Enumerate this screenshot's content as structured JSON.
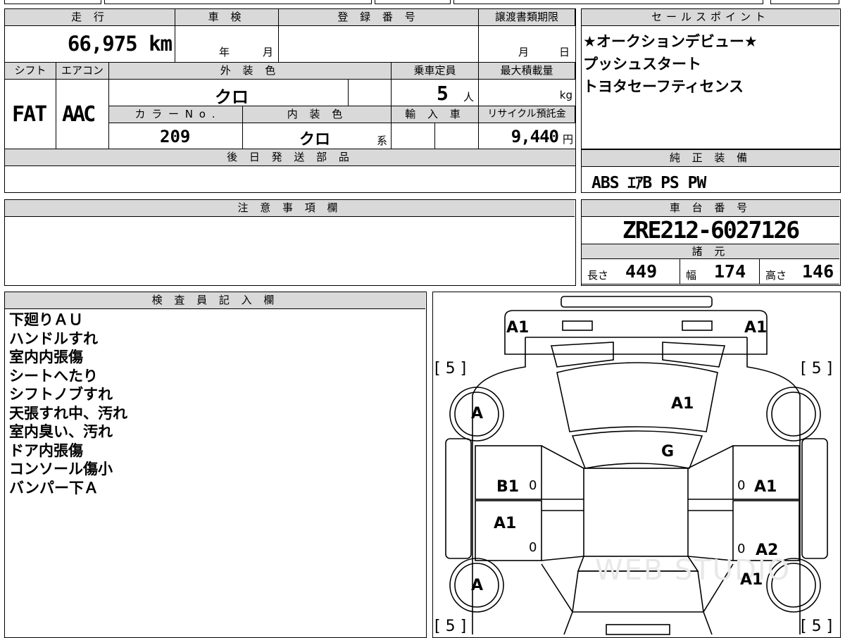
{
  "summary": {
    "mileage_label": "走 行",
    "mileage_value": "66,975 km",
    "shaken_label": "車 検",
    "shaken_year": "年",
    "shaken_month": "月",
    "registration_label": "登 録 番 号",
    "transfer_label": "譲渡書類期限",
    "transfer_month": "月",
    "transfer_day": "日",
    "shift_label": "シフト",
    "shift_value": "FAT",
    "aircon_label": "エアコン",
    "aircon_value": "AAC",
    "exterior_color_label": "外 装 色",
    "exterior_color_value": "クロ",
    "capacity_label": "乗車定員",
    "capacity_value": "5",
    "capacity_unit": "人",
    "max_load_label": "最大積載量",
    "max_load_unit": "kg",
    "color_no_label": "カ ラ ー N o .",
    "color_no_value": "209",
    "interior_color_label": "内 装 色",
    "interior_color_value": "クロ",
    "interior_color_suffix": "系",
    "import_label": "輸 入 車",
    "recycle_label": "リサイクル預託金",
    "recycle_value": "9,440",
    "recycle_unit": "円",
    "later_parts_label": "後 日 発 送 部 品"
  },
  "sales_points": {
    "label": "セールスポイント",
    "lines": [
      "★オークションデビュー★",
      "プッシュスタート",
      "トヨタセーフティセンス"
    ]
  },
  "equipment": {
    "label": "純 正 装 備",
    "value": "ABS ｴｱB PS PW"
  },
  "notes": {
    "label": "注 意 事 項 欄"
  },
  "chassis": {
    "label": "車 台 番 号",
    "value": "ZRE212-6027126",
    "dims_label": "諸 元",
    "length_label": "長さ",
    "length_value": "449",
    "width_label": "幅",
    "width_value": "174",
    "height_label": "高さ",
    "height_value": "146"
  },
  "inspector": {
    "label": "検 査 員 記 入 欄",
    "lines": [
      "下廻りＡＵ",
      "ハンドルすれ",
      "室内内張傷",
      "シートへたり",
      "シフトノブすれ",
      "天張すれ中、汚れ",
      "室内臭い、汚れ",
      "ドア内張傷",
      "コンソール傷小",
      "バンパー下Ａ"
    ]
  },
  "diagram": {
    "front_left": "A1",
    "front_right": "A1",
    "tire_tl": "[ 5 ]",
    "tire_tr": "[ 5 ]",
    "tire_bl": "[ 5 ]",
    "tire_br": "[ 5 ]",
    "wheel_front_left": "A",
    "wheel_rear_left": "A",
    "hood": "A1",
    "windshield": "G",
    "left_front_door": "B1",
    "left_rear_door": "A1",
    "right_front_door": "A1",
    "right_rear_door": "A2",
    "right_rear_fender": "A1",
    "handle": "0",
    "watermark": "WEB STUDIO"
  }
}
